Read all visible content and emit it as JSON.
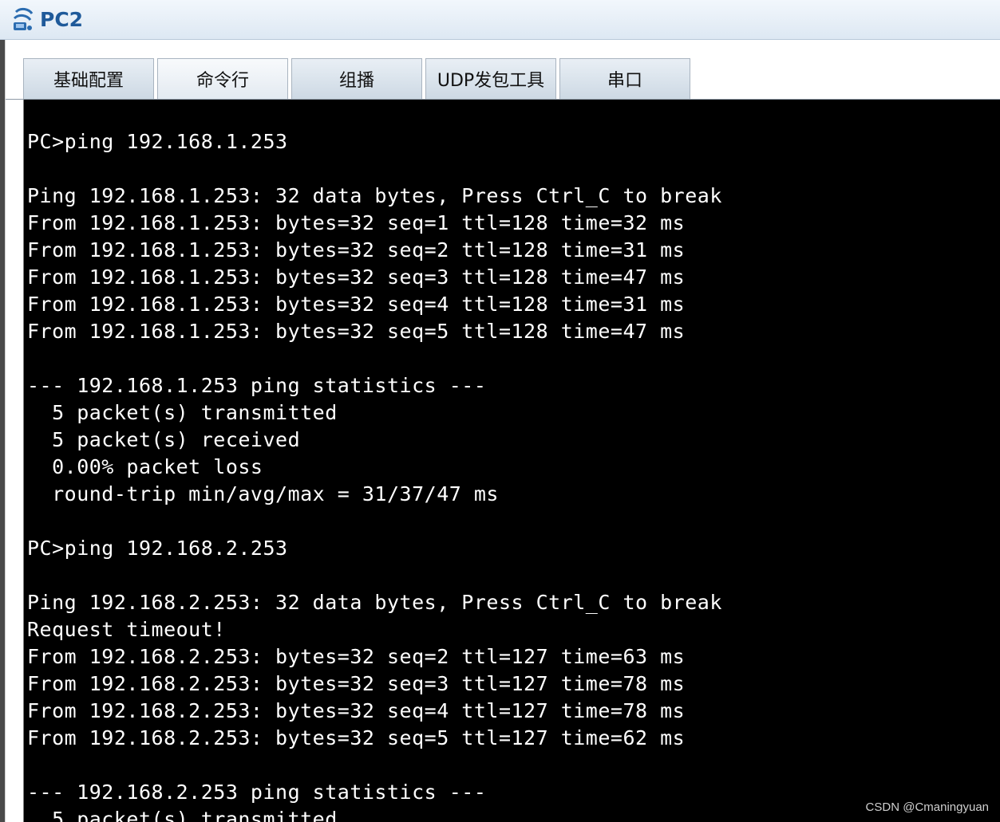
{
  "window": {
    "title": "PC2",
    "icon": "pc-network-icon",
    "accent_color": "#1f5a9a"
  },
  "tabs": [
    {
      "label": "基础配置",
      "active": false
    },
    {
      "label": "命令行",
      "active": true
    },
    {
      "label": "组播",
      "active": false
    },
    {
      "label": "UDP发包工具",
      "active": false
    },
    {
      "label": "串口",
      "active": false
    }
  ],
  "terminal": {
    "background": "#000000",
    "foreground": "#ffffff",
    "lines": [
      "",
      "PC>ping 192.168.1.253",
      "",
      "Ping 192.168.1.253: 32 data bytes, Press Ctrl_C to break",
      "From 192.168.1.253: bytes=32 seq=1 ttl=128 time=32 ms",
      "From 192.168.1.253: bytes=32 seq=2 ttl=128 time=31 ms",
      "From 192.168.1.253: bytes=32 seq=3 ttl=128 time=47 ms",
      "From 192.168.1.253: bytes=32 seq=4 ttl=128 time=31 ms",
      "From 192.168.1.253: bytes=32 seq=5 ttl=128 time=47 ms",
      "",
      "--- 192.168.1.253 ping statistics ---",
      "  5 packet(s) transmitted",
      "  5 packet(s) received",
      "  0.00% packet loss",
      "  round-trip min/avg/max = 31/37/47 ms",
      "",
      "PC>ping 192.168.2.253",
      "",
      "Ping 192.168.2.253: 32 data bytes, Press Ctrl_C to break",
      "Request timeout!",
      "From 192.168.2.253: bytes=32 seq=2 ttl=127 time=63 ms",
      "From 192.168.2.253: bytes=32 seq=3 ttl=127 time=78 ms",
      "From 192.168.2.253: bytes=32 seq=4 ttl=127 time=78 ms",
      "From 192.168.2.253: bytes=32 seq=5 ttl=127 time=62 ms",
      "",
      "--- 192.168.2.253 ping statistics ---",
      "  5 packet(s) transmitted"
    ]
  },
  "watermark": "CSDN @Cmaningyuan"
}
